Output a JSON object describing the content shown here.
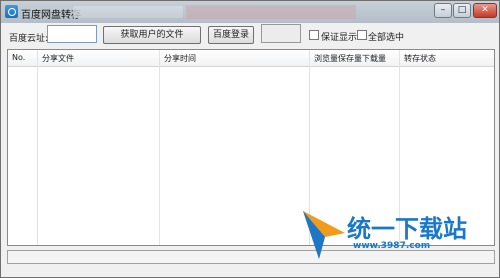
{
  "window": {
    "title": "百度网盘转存",
    "controls": {
      "minimize": "–",
      "maximize": "□",
      "close": "✕"
    }
  },
  "toolbar": {
    "url_label": "百度云址:",
    "url_value": "",
    "fetch_button": "获取用户的文件",
    "login_button": "百度登录",
    "checkbox_verify": "保证显示",
    "checkbox_all": "全部选中"
  },
  "table": {
    "columns": [
      "No.",
      "分享文件",
      "分享时间",
      "浏览量保存量下载量",
      "转存状态"
    ],
    "rows": []
  },
  "watermark": {
    "text": "统一下载站",
    "site": "www.3987.com"
  }
}
